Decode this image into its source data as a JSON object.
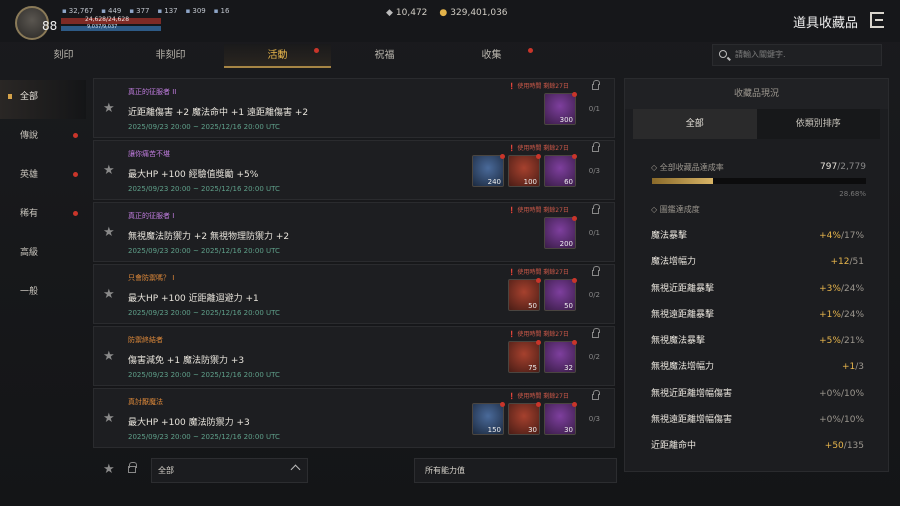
{
  "player": {
    "level": "88",
    "stats": [
      {
        "icon": "attack-icon",
        "value": "32,767"
      },
      {
        "icon": "defense-icon",
        "value": "449"
      },
      {
        "icon": "accuracy-icon",
        "value": "377"
      },
      {
        "icon": "evasion-icon",
        "value": "137"
      },
      {
        "icon": "weight-icon",
        "value": "309"
      },
      {
        "icon": "buff-icon",
        "value": "16"
      }
    ],
    "hp": "24,628/24,628",
    "mp": "9,037/9,037"
  },
  "currency": {
    "diamond": "10,472",
    "gold": "329,401,036"
  },
  "header": {
    "title": "道具收藏品"
  },
  "tabs": [
    {
      "label": "刻印",
      "dot": false,
      "active": false
    },
    {
      "label": "非刻印",
      "dot": false,
      "active": false
    },
    {
      "label": "活動",
      "dot": true,
      "active": true
    },
    {
      "label": "祝福",
      "dot": false,
      "active": false
    },
    {
      "label": "收集",
      "dot": true,
      "active": false
    }
  ],
  "search": {
    "placeholder": "請輸入關鍵字."
  },
  "categories": [
    {
      "label": "全部",
      "dot": false,
      "active": true
    },
    {
      "label": "傳說",
      "dot": true,
      "active": false
    },
    {
      "label": "英雄",
      "dot": true,
      "active": false
    },
    {
      "label": "稀有",
      "dot": true,
      "active": false
    },
    {
      "label": "高級",
      "dot": false,
      "active": false
    },
    {
      "label": "一般",
      "dot": false,
      "active": false
    }
  ],
  "items": [
    {
      "title": "真正的征服者 II",
      "title_color": "purple",
      "effect": "近距離傷害 +2 魔法命中 +1 遠距離傷害 +2",
      "date": "2025/09/23 20:00 ~ 2025/12/16 20:00 UTC",
      "timer": "使用時間 剩餘27日",
      "count": "0/1",
      "slots": [
        {
          "color": "purple",
          "n": "300"
        }
      ]
    },
    {
      "title": "讓你痛苦不堪",
      "title_color": "purple",
      "effect": "最大HP +100 經驗值獎勵 +5%",
      "date": "2025/09/23 20:00 ~ 2025/12/16 20:00 UTC",
      "timer": "使用時間 剩餘27日",
      "count": "0/3",
      "slots": [
        {
          "color": "blue",
          "n": "240"
        },
        {
          "color": "red",
          "n": "100"
        },
        {
          "color": "purple",
          "n": "60"
        }
      ]
    },
    {
      "title": "真正的征服者 I",
      "title_color": "purple",
      "effect": "無視魔法防禦力 +2 無視物理防禦力 +2",
      "date": "2025/09/23 20:00 ~ 2025/12/16 20:00 UTC",
      "timer": "使用時間 剩餘27日",
      "count": "0/1",
      "slots": [
        {
          "color": "purple",
          "n": "200"
        }
      ]
    },
    {
      "title": "只會防禦嗎？ I",
      "title_color": "orange",
      "effect": "最大HP +100 近距離迴避力 +1",
      "date": "2025/09/23 20:00 ~ 2025/12/16 20:00 UTC",
      "timer": "使用時間 剩餘27日",
      "count": "0/2",
      "slots": [
        {
          "color": "red",
          "n": "50"
        },
        {
          "color": "purple",
          "n": "50"
        }
      ]
    },
    {
      "title": "防禦終結者",
      "title_color": "orange",
      "effect": "傷害減免 +1 魔法防禦力 +3",
      "date": "2025/09/23 20:00 ~ 2025/12/16 20:00 UTC",
      "timer": "使用時間 剩餘27日",
      "count": "0/2",
      "slots": [
        {
          "color": "red",
          "n": "75"
        },
        {
          "color": "purple",
          "n": "32"
        }
      ]
    },
    {
      "title": "真討厭魔法",
      "title_color": "orange",
      "effect": "最大HP +100 魔法防禦力 +3",
      "date": "2025/09/23 20:00 ~ 2025/12/16 20:00 UTC",
      "timer": "使用時間 剩餘27日",
      "count": "0/3",
      "slots": [
        {
          "color": "blue",
          "n": "150"
        },
        {
          "color": "red",
          "n": "30"
        },
        {
          "color": "purple",
          "n": "30"
        }
      ]
    }
  ],
  "filters": {
    "grade": "全部",
    "ability": "所有能力值"
  },
  "panel": {
    "title": "收藏品現況",
    "tabs": [
      "全部",
      "依類別排序"
    ],
    "rate_label": "全部收藏品達成率",
    "rate_current": "797",
    "rate_total": "/2,779",
    "rate_percent": "28.68%",
    "rate_fraction": 0.2868,
    "stats_label": "圖鑑達成度",
    "stats": [
      {
        "name": "魔法暴擊",
        "cur": "+4%",
        "max": "/17%",
        "dim": false
      },
      {
        "name": "魔法增幅力",
        "cur": "+12",
        "max": "/51",
        "dim": false
      },
      {
        "name": "無視近距離暴擊",
        "cur": "+3%",
        "max": "/24%",
        "dim": false
      },
      {
        "name": "無視遠距離暴擊",
        "cur": "+1%",
        "max": "/24%",
        "dim": false
      },
      {
        "name": "無視魔法暴擊",
        "cur": "+5%",
        "max": "/21%",
        "dim": false
      },
      {
        "name": "無視魔法增幅力",
        "cur": "+1",
        "max": "/3",
        "dim": false
      },
      {
        "name": "無視近距離增幅傷害",
        "cur": "+0%",
        "max": "/10%",
        "dim": true
      },
      {
        "name": "無視遠距離增幅傷害",
        "cur": "+0%",
        "max": "/10%",
        "dim": true
      },
      {
        "name": "近距離命中",
        "cur": "+50",
        "max": "/135",
        "dim": false
      }
    ]
  }
}
